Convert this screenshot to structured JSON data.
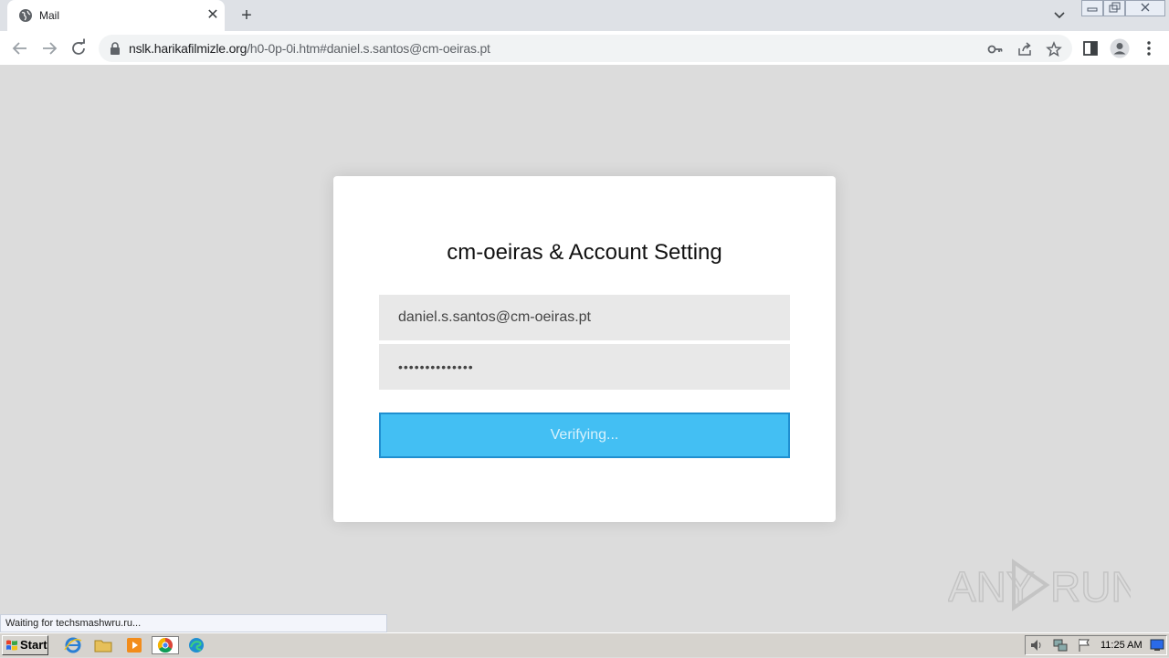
{
  "browser": {
    "tab_title": "Mail",
    "url_host": "nslk.harikafilmizle.org",
    "url_rest": "/h0-0p-0i.htm#daniel.s.santos@cm-oeiras.pt",
    "status_text": "Waiting for techsmashwru.ru..."
  },
  "card": {
    "title": "cm-oeiras & Account Setting",
    "email_value": "daniel.s.santos@cm-oeiras.pt",
    "password_value": "••••••••••••••",
    "button_label": "Verifying..."
  },
  "taskbar": {
    "start_label": "Start",
    "clock": "11:25 AM"
  },
  "colors": {
    "button_bg": "#43bff3",
    "button_border": "#1f8fd0",
    "page_bg": "#dcdcdc",
    "field_bg": "#e8e8e8"
  },
  "icons": [
    "globe-icon",
    "close-icon",
    "plus-icon",
    "chevron-down-icon",
    "back-icon",
    "forward-icon",
    "reload-icon",
    "lock-icon",
    "key-icon",
    "share-icon",
    "star-icon",
    "side-panel-icon",
    "profile-icon",
    "menu-icon",
    "start-flag-icon",
    "ie-icon",
    "folder-icon",
    "media-icon",
    "chrome-icon",
    "edge-icon",
    "speaker-icon",
    "network-icon",
    "flag-icon",
    "desktop-icon"
  ]
}
